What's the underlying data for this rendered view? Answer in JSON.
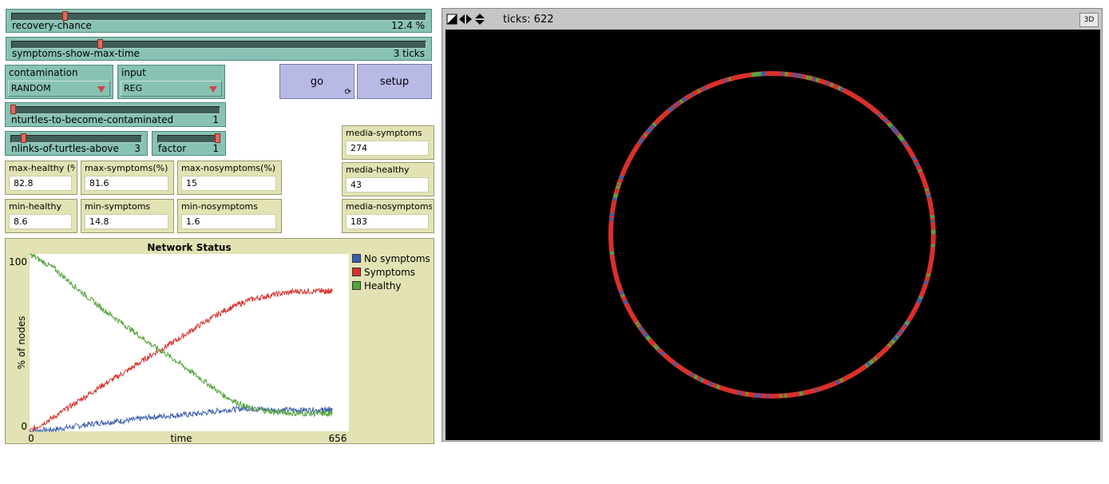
{
  "sliders": {
    "recovery_chance": {
      "label": "recovery-chance",
      "value": "12.4 %",
      "fraction": 0.124
    },
    "symptoms_show_max_time": {
      "label": "symptoms-show-max-time",
      "value": "3 ticks",
      "fraction": 0.21
    },
    "nturtles": {
      "label": "nturtles-to-become-contaminated",
      "value": "1",
      "fraction": 0.0
    },
    "nlinks": {
      "label": "nlinks-of-turtles-above",
      "value": "3",
      "fraction": 0.08
    },
    "factor": {
      "label": "factor",
      "value": "1",
      "fraction": 1.0
    }
  },
  "choosers": {
    "contamination": {
      "label": "contamination",
      "selected": "RANDOM"
    },
    "input": {
      "label": "input",
      "selected": "REG"
    }
  },
  "buttons": {
    "go": "go",
    "setup": "setup",
    "forever_glyph": "⟳"
  },
  "monitors": {
    "max_healthy": {
      "label": "max-healthy (%",
      "value": "82.8"
    },
    "max_symptoms": {
      "label": "max-symptoms(%)",
      "value": "81.6"
    },
    "max_nosymptoms": {
      "label": "max-nosymptoms(%)",
      "value": "15"
    },
    "min_healthy": {
      "label": "min-healthy",
      "value": "8.6"
    },
    "min_symptoms": {
      "label": "min-symptoms",
      "value": "14.8"
    },
    "min_nosymptoms": {
      "label": "min-nosymptoms",
      "value": "1.6"
    },
    "media_symptoms": {
      "label": "media-symptoms",
      "value": "274"
    },
    "media_healthy": {
      "label": "media-healthy",
      "value": "43"
    },
    "media_nosymptoms": {
      "label": "media-nosymptoms",
      "value": "183"
    }
  },
  "view": {
    "ticks_label": "ticks: 622",
    "btn_3d": "3D",
    "background": "#000000"
  },
  "chart_data": {
    "type": "line",
    "title": "Network Status",
    "xlabel": "time",
    "ylabel": "% of nodes",
    "xlim": [
      0,
      656
    ],
    "ylim": [
      0,
      100
    ],
    "x_tick_labels": [
      "0",
      "656"
    ],
    "y_tick_labels": [
      "0",
      "100"
    ],
    "legend_position": "right",
    "x": [
      0,
      50,
      100,
      150,
      200,
      250,
      300,
      350,
      400,
      450,
      500,
      550,
      600,
      622
    ],
    "series": [
      {
        "name": "No symptoms",
        "color": "#3b5eac",
        "values": [
          0,
          1,
          3,
          5,
          6,
          8,
          9,
          10,
          12,
          13,
          12,
          12,
          12,
          12
        ]
      },
      {
        "name": "Symptoms",
        "color": "#d9302a",
        "values": [
          0,
          8,
          17,
          26,
          34,
          43,
          51,
          60,
          68,
          74,
          77,
          79,
          79,
          79
        ]
      },
      {
        "name": "Healthy",
        "color": "#52a53a",
        "values": [
          100,
          92,
          80,
          69,
          59,
          49,
          40,
          30,
          20,
          13,
          11,
          10,
          10,
          10
        ]
      }
    ]
  }
}
